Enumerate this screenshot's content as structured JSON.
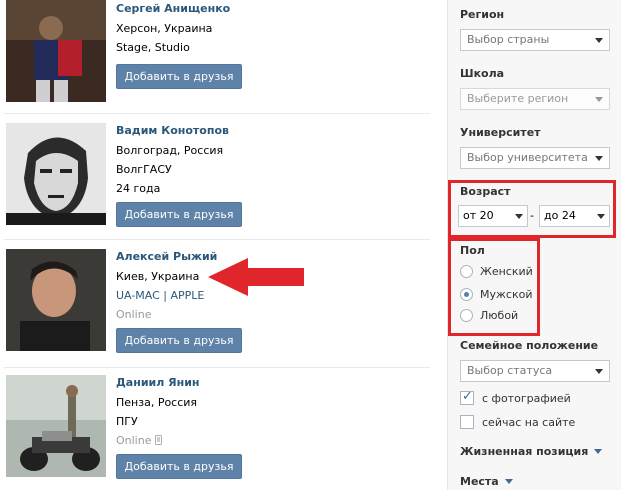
{
  "add_friend_label": "Добавить в друзья",
  "people": [
    {
      "name": "Сергей Анищенко",
      "lines": [
        "Херсон, Украина",
        "Stage, Studio"
      ],
      "online": ""
    },
    {
      "name": "Вадим Конотопов",
      "lines": [
        "Волгоград, Россия",
        "ВолгГАСУ",
        "24 года"
      ],
      "online": ""
    },
    {
      "name": "Алексей Рыжий",
      "lines": [
        "Киев, Украина"
      ],
      "link": "UA-MAC | APPLE",
      "online": "Online"
    },
    {
      "name": "Даниил Янин",
      "lines": [
        "Пенза, Россия",
        "ПГУ"
      ],
      "online": "Online"
    }
  ],
  "filters": {
    "region_label": "Регион",
    "country_select": "Выбор страны",
    "school_label": "Школа",
    "region_select": "Выберите регион",
    "university_label": "Университет",
    "university_select": "Выбор университета",
    "age_label": "Возраст",
    "age_from": "от 20",
    "age_dash": "-",
    "age_to": "до 24",
    "sex_label": "Пол",
    "sex_options": [
      {
        "label": "Женский",
        "checked": false
      },
      {
        "label": "Мужской",
        "checked": true
      },
      {
        "label": "Любой",
        "checked": false
      }
    ],
    "marital_label": "Семейное положение",
    "status_select": "Выбор статуса",
    "with_photo": "с фотографией",
    "online_now": "сейчас на сайте",
    "life_position": "Жизненная позиция",
    "places": "Места"
  },
  "colors": {
    "button": "#5e82a8",
    "link": "#2b587a",
    "highlight": "#e0262b"
  },
  "icons": [
    "arrow-icon",
    "mobile-icon",
    "chevron-down-icon"
  ]
}
